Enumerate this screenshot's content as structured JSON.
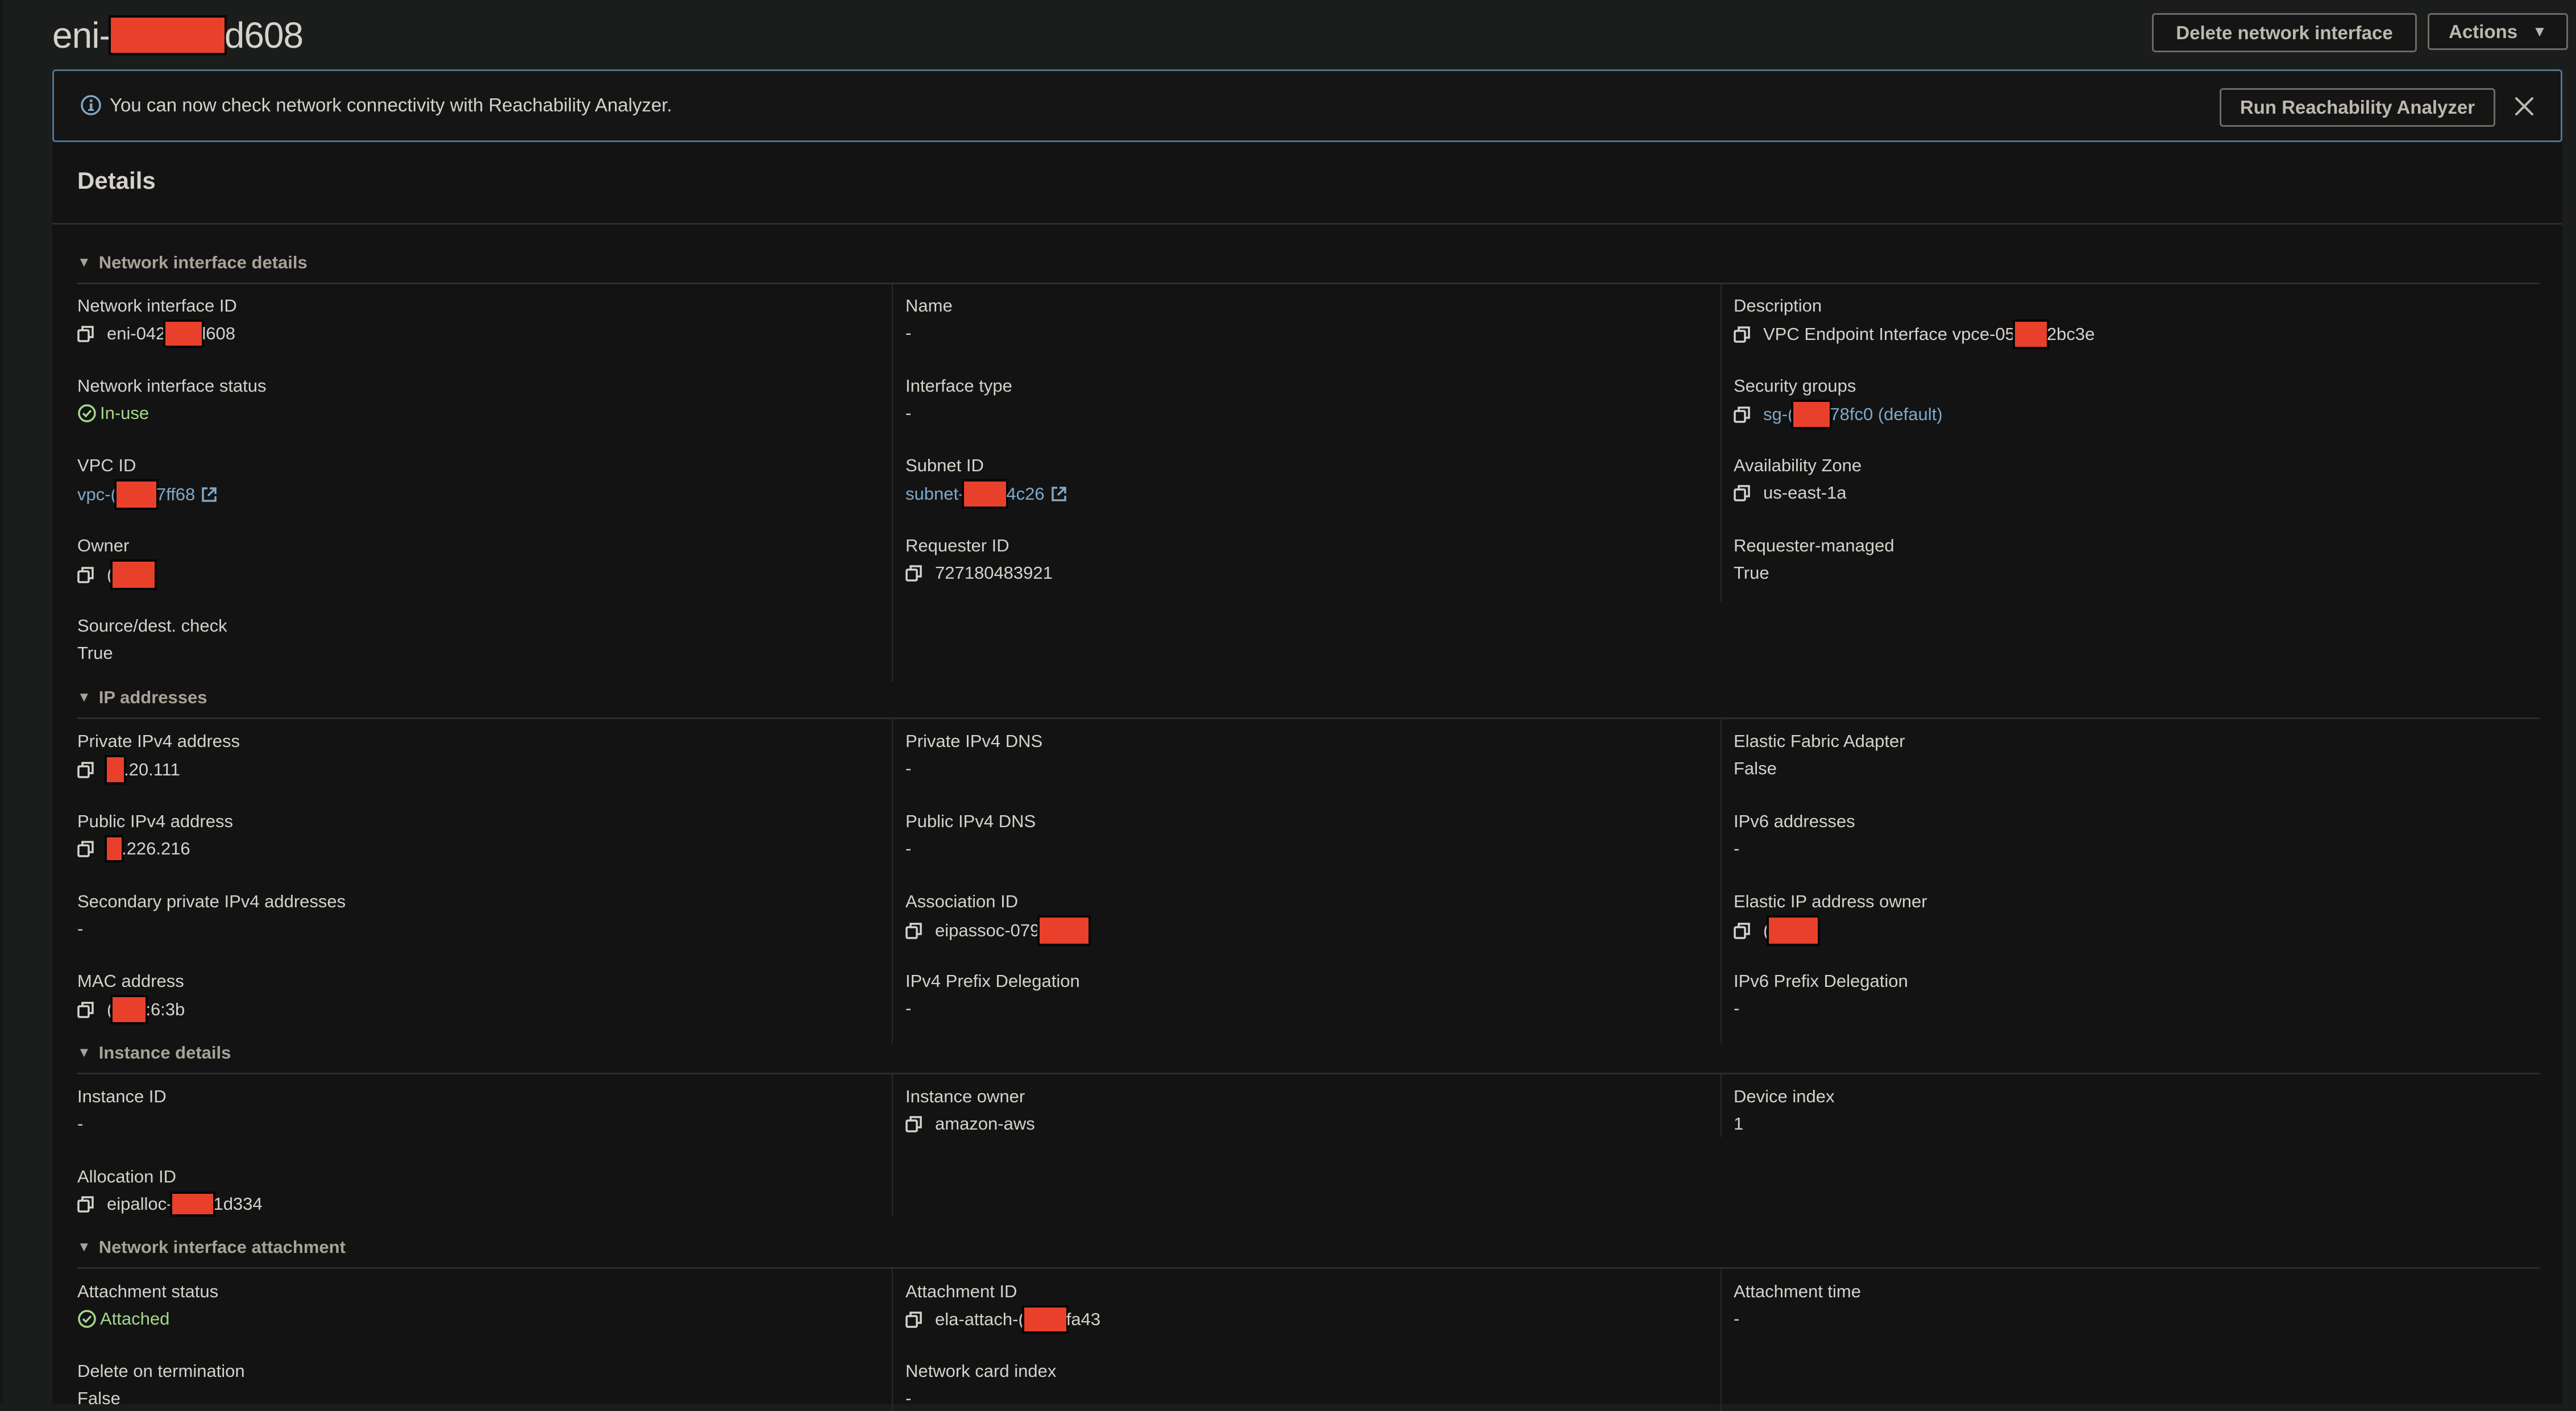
{
  "page": {
    "title_prefix": "eni-",
    "title_suffix": "d608",
    "buttons": {
      "delete": "Delete network interface",
      "actions": "Actions"
    }
  },
  "banner": {
    "icon": "info-icon",
    "message": "You can now check network connectivity with Reachability Analyzer.",
    "run_button": "Run Reachability Analyzer",
    "close_icon": "close-icon"
  },
  "details": {
    "title": "Details",
    "sections": {
      "network_interface_details": {
        "title": "Network interface details",
        "fields": {
          "network_interface_id": {
            "label": "Network interface ID",
            "prefix": "eni-042",
            "suffix": "l608"
          },
          "network_interface_status": {
            "label": "Network interface status",
            "value": "In-use"
          },
          "vpc_id": {
            "label": "VPC ID",
            "prefix": "vpc-(",
            "suffix": "7ff68"
          },
          "owner": {
            "label": "Owner",
            "prefix": "("
          },
          "source_dest_check": {
            "label": "Source/dest. check",
            "value": "True"
          },
          "name": {
            "label": "Name",
            "value": "-"
          },
          "interface_type": {
            "label": "Interface type",
            "value": "-"
          },
          "subnet_id": {
            "label": "Subnet ID",
            "prefix": "subnet-",
            "suffix": "4c26"
          },
          "requester_id": {
            "label": "Requester ID",
            "value": "727180483921"
          },
          "description": {
            "label": "Description",
            "prefix": "VPC Endpoint Interface vpce-05",
            "suffix": "2bc3e"
          },
          "security_groups": {
            "label": "Security groups",
            "prefix": "sg-(",
            "suffix": "78fc0 (default)"
          },
          "availability_zone": {
            "label": "Availability Zone",
            "value": "us-east-1a"
          },
          "requester_managed": {
            "label": "Requester-managed",
            "value": "True"
          }
        }
      },
      "ip_addresses": {
        "title": "IP addresses",
        "fields": {
          "private_ipv4": {
            "label": "Private IPv4 address",
            "suffix": ".20.111"
          },
          "public_ipv4": {
            "label": "Public IPv4 address",
            "suffix": ".226.216"
          },
          "secondary_private_ipv4": {
            "label": "Secondary private IPv4 addresses",
            "value": "-"
          },
          "mac_address": {
            "label": "MAC address",
            "prefix": "(",
            "suffix": ":6:3b"
          },
          "private_ipv4_dns": {
            "label": "Private IPv4 DNS",
            "value": "-"
          },
          "public_ipv4_dns": {
            "label": "Public IPv4 DNS",
            "value": "-"
          },
          "association_id": {
            "label": "Association ID",
            "prefix": "eipassoc-079"
          },
          "ipv4_prefix_delegation": {
            "label": "IPv4 Prefix Delegation",
            "value": "-"
          },
          "elastic_fabric_adapter": {
            "label": "Elastic Fabric Adapter",
            "value": "False"
          },
          "ipv6_addresses": {
            "label": "IPv6 addresses",
            "value": "-"
          },
          "elastic_ip_owner": {
            "label": "Elastic IP address owner",
            "prefix": "("
          },
          "ipv6_prefix_delegation": {
            "label": "IPv6 Prefix Delegation",
            "value": "-"
          }
        }
      },
      "instance_details": {
        "title": "Instance details",
        "fields": {
          "instance_id": {
            "label": "Instance ID",
            "value": "-"
          },
          "allocation_id": {
            "label": "Allocation ID",
            "prefix": "eipalloc-",
            "suffix": "1d334"
          },
          "instance_owner": {
            "label": "Instance owner",
            "value": "amazon-aws"
          },
          "device_index": {
            "label": "Device index",
            "value": "1"
          }
        }
      },
      "attachment": {
        "title": "Network interface attachment",
        "fields": {
          "attachment_status": {
            "label": "Attachment status",
            "value": "Attached"
          },
          "delete_on_termination": {
            "label": "Delete on termination",
            "value": "False"
          },
          "attachment_id": {
            "label": "Attachment ID",
            "prefix": "ela-attach-(",
            "suffix": "fa43"
          },
          "network_card_index": {
            "label": "Network card index",
            "value": "-"
          },
          "attachment_time": {
            "label": "Attachment time",
            "value": "-"
          }
        }
      }
    }
  },
  "colors": {
    "background": "#1b1c1c",
    "panel": "#131313",
    "text": "#d5d2cb",
    "link": "#7fa8c9",
    "success": "#a4d78c",
    "banner_border": "#4f7391",
    "redaction": "#e8402a"
  }
}
